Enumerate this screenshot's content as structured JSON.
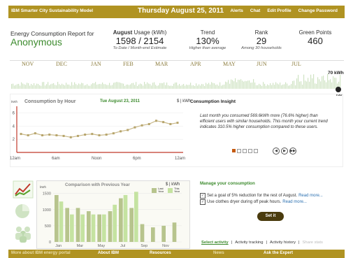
{
  "header": {
    "app_title": "IBM Smarter City Sustainability Model",
    "date": "Thursday August 25, 2011",
    "links": [
      "Alerts",
      "Chat",
      "Edit Profile",
      "Change Password"
    ]
  },
  "report": {
    "label": "Energy Consumption Report for",
    "user": "Anonymous"
  },
  "stats": {
    "usage": {
      "heading_bold": "August",
      "heading": " Usage (kWh)",
      "value": "1598 / 2154",
      "sub": "To Date / Month-end Estimate"
    },
    "trend": {
      "heading": "Trend",
      "value": "130%",
      "sub": "Higher than average"
    },
    "rank": {
      "heading": "Rank",
      "value": "29",
      "sub": "Among 30 households"
    },
    "points": {
      "heading": "Green Points",
      "value": "460"
    }
  },
  "timeline": {
    "months": [
      "NOV",
      "DEC",
      "JAN",
      "FEB",
      "MAR",
      "APR",
      "MAY",
      "JUN",
      "JUL"
    ],
    "peak_label": "70 kWh",
    "today_label": "TOD"
  },
  "consumption_by_hour": {
    "title": "Consumption by Hour",
    "date": "Tue August 23, 2011",
    "unit": "$ | kWh",
    "y_unit": "kWh",
    "xticks": [
      "12am",
      "6am",
      "Noon",
      "6pm",
      "12am"
    ]
  },
  "insight": {
    "title": "Consumption Insight",
    "text": "Last month you consumed 569.6kWh more (76.6% higher) than efficient users with similar households. This month your current trend indicates 310.5% higher consumption compared to these users."
  },
  "comparison": {
    "title": "Comparison with Previous Year",
    "unit": "$ | kWh",
    "y_unit": "kWh",
    "legend": [
      "Last Year",
      "This Year"
    ]
  },
  "manage": {
    "title": "Manage your consumption",
    "items": [
      {
        "text": "Set a goal of 5% reduction for the rest of August.",
        "more": "Read more..."
      },
      {
        "text": "Use clothes dryer during off peak hours.",
        "more": "Read more..."
      }
    ],
    "button": "Set it"
  },
  "tabs": [
    "Select activity",
    "|",
    "Activity tracking",
    "|",
    "Activity history",
    "|",
    "Share stats"
  ],
  "footer": [
    "More about IBM energy portal",
    "About IBM",
    "Resources",
    "News",
    "Ask the Expert"
  ],
  "colors": {
    "brand_bar": "#b09322",
    "accent_green": "#3d8b2e",
    "line_red": "#c0392b"
  },
  "chart_data": [
    {
      "type": "line",
      "title": "Consumption by Hour",
      "ylabel": "kWh",
      "ylim": [
        0,
        7
      ],
      "yticks": [
        2,
        4,
        6
      ],
      "x": [
        0,
        1,
        2,
        3,
        4,
        5,
        6,
        7,
        8,
        9,
        10,
        11,
        12,
        13,
        14,
        15,
        16,
        17,
        18,
        19,
        20,
        21,
        22
      ],
      "values": [
        2.8,
        2.6,
        2.9,
        2.6,
        2.7,
        2.6,
        2.5,
        2.3,
        2.5,
        2.7,
        2.8,
        2.6,
        2.7,
        2.9,
        3.2,
        3.4,
        3.8,
        4.1,
        4.3,
        4.8,
        4.6,
        4.3,
        4.5
      ]
    },
    {
      "type": "bar",
      "title": "Comparison with Previous Year",
      "ylabel": "kWh",
      "ylim": [
        0,
        1600
      ],
      "yticks": [
        0,
        500,
        1000,
        1500
      ],
      "categories": [
        "Jan",
        "Feb",
        "Mar",
        "Apr",
        "May",
        "Jun",
        "Jul",
        "Aug",
        "Sep",
        "Oct",
        "Nov",
        "Dec"
      ],
      "xticks": [
        "Jan",
        "Mar",
        "May",
        "Jul",
        "Sep",
        "Nov"
      ],
      "series": [
        {
          "name": "Last Year",
          "values": [
            1450,
            1050,
            1050,
            950,
            850,
            950,
            1350,
            1050,
            550,
            450,
            500,
            600
          ]
        },
        {
          "name": "This Year",
          "values": [
            1250,
            850,
            850,
            850,
            850,
            1150,
            1450,
            1550,
            0,
            0,
            0,
            0
          ]
        }
      ]
    }
  ]
}
